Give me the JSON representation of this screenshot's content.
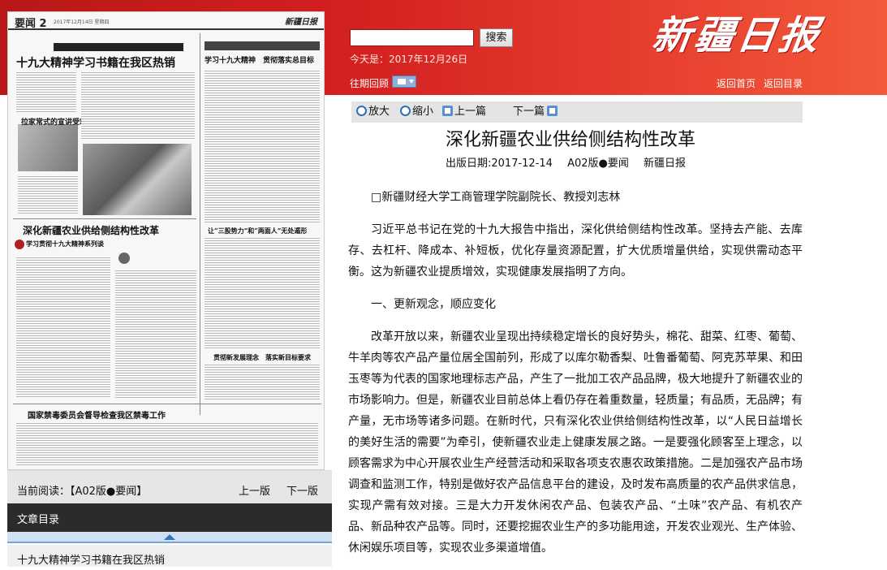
{
  "header": {
    "search_placeholder": "",
    "search_button": "搜索",
    "today": "今天是：2017年12月26日",
    "archive_label": "往期回顾",
    "home_link": "返回首页",
    "toc_link": "返回目录",
    "logo": "新疆日报"
  },
  "paper_page": {
    "section": "要闻 2",
    "date_line": "2017年12月14日 星期四",
    "masthead": "新疆日报",
    "headlines": [
      "十九大精神学习书籍在我区热销",
      "学习十九大精神　贯彻落实总目标",
      "拉家常式的宣讲受欢迎",
      "深化新疆农业供给侧结构性改革",
      "学习贯彻十九大精神系列谈",
      "让“三股势力”和“两面人”无处遁形",
      "贯彻新发展理念　落实新目标要求",
      "国家禁毒委员会督导检查我区禁毒工作"
    ]
  },
  "reader": {
    "current_label": "当前阅读：【A02版●要闻】",
    "prev_page": "上一版",
    "next_page": "下一版",
    "toc_title": "文章目录",
    "toc_items": [
      "十九大精神学习书籍在我区热销"
    ]
  },
  "toolbar": {
    "zoom_in": "放大",
    "zoom_out": "缩小",
    "prev_article": "上一篇",
    "next_article": "下一篇"
  },
  "article": {
    "title": "深化新疆农业供给侧结构性改革",
    "pub_date": "出版日期:2017-12-14",
    "edition": "A02版●要闻",
    "source": "新疆日报",
    "paragraphs": [
      "□新疆财经大学工商管理学院副院长、教授刘志林",
      "习近平总书记在党的十九大报告中指出，深化供给侧结构性改革。坚持去产能、去库存、去杠杆、降成本、补短板，优化存量资源配置，扩大优质增量供给，实现供需动态平衡。这为新疆农业提质增效，实现健康发展指明了方向。",
      "一、更新观念，顺应变化",
      "改革开放以来，新疆农业呈现出持续稳定增长的良好势头，棉花、甜菜、红枣、葡萄、牛羊肉等农产品产量位居全国前列，形成了以库尔勒香梨、吐鲁番葡萄、阿克苏苹果、和田玉枣等为代表的国家地理标志产品，产生了一批加工农产品品牌，极大地提升了新疆农业的市场影响力。但是，新疆农业目前总体上看仍存在着重数量，轻质量；有品质，无品牌；有产量，无市场等诸多问题。在新时代，只有深化农业供给侧结构性改革，以“人民日益增长的美好生活的需要”为牵引，使新疆农业走上健康发展之路。一是要强化顾客至上理念，以顾客需求为中心开展农业生产经营活动和采取各项支农惠农政策措施。二是加强农产品市场调查和监测工作，特别是做好农产品信息平台的建设，及时发布高质量的农产品供求信息，实现产需有效对接。三是大力开发休闲农产品、包装农产品、“土味”农产品、有机农产品、新品种农产品等。同时，还要挖掘农业生产的多功能用途，开发农业观光、生产体验、休闲娱乐项目等，实现农业多渠道增值。"
    ]
  }
}
